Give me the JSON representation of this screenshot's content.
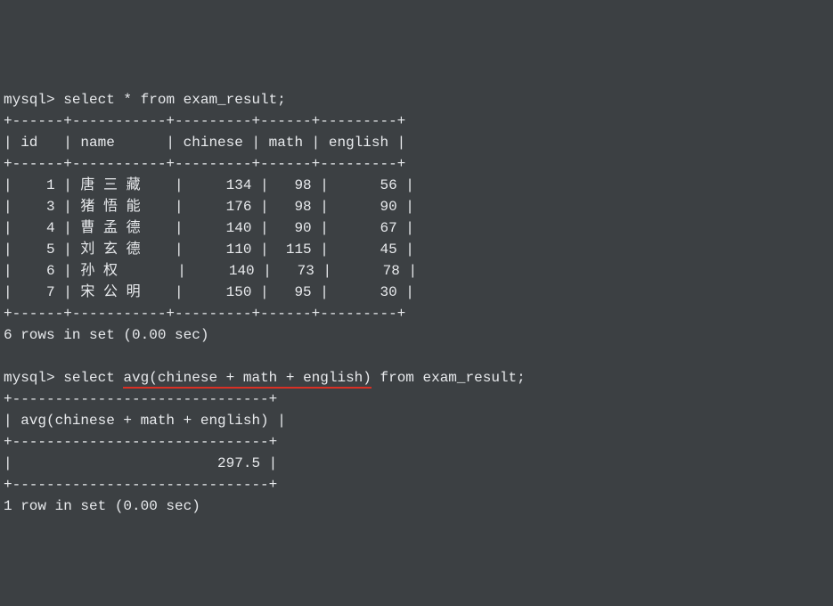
{
  "prompts": {
    "prompt1": "mysql> ",
    "query1": "select * from exam_result;",
    "prompt2": "mysql> ",
    "query2_pre": "select ",
    "query2_underlined": "avg(chinese + math + english)",
    "query2_post": " from exam_result;"
  },
  "table1": {
    "border_top": "+------+-----------+---------+------+---------+",
    "header": "| id   | name      | chinese | math | english |",
    "border_mid": "+------+-----------+---------+------+---------+",
    "row1": "|    1 | 唐 三 藏    |     134 |   98 |      56 |",
    "row2": "|    3 | 猪 悟 能    |     176 |   98 |      90 |",
    "row3": "|    4 | 曹 孟 德    |     140 |   90 |      67 |",
    "row4": "|    5 | 刘 玄 德    |     110 |  115 |      45 |",
    "row5": "|    6 | 孙 权       |     140 |   73 |      78 |",
    "row6": "|    7 | 宋 公 明    |     150 |   95 |      30 |",
    "border_bot": "+------+-----------+---------+------+---------+",
    "summary": "6 rows in set (0.00 sec)"
  },
  "table2": {
    "border_top": "+------------------------------+",
    "header": "| avg(chinese + math + english) |",
    "border_mid": "+------------------------------+",
    "row1": "|                        297.5 |",
    "border_bot": "+------------------------------+",
    "summary": "1 row in set (0.00 sec)"
  },
  "chart_data": {
    "type": "table",
    "tables": [
      {
        "query": "select * from exam_result;",
        "columns": [
          "id",
          "name",
          "chinese",
          "math",
          "english"
        ],
        "rows": [
          [
            1,
            "唐三藏",
            134,
            98,
            56
          ],
          [
            3,
            "猪悟能",
            176,
            98,
            90
          ],
          [
            4,
            "曹孟德",
            140,
            90,
            67
          ],
          [
            5,
            "刘玄德",
            110,
            115,
            45
          ],
          [
            6,
            "孙权",
            140,
            73,
            78
          ],
          [
            7,
            "宋公明",
            150,
            95,
            30
          ]
        ],
        "row_count": 6,
        "time_sec": 0.0
      },
      {
        "query": "select avg(chinese + math + english) from exam_result;",
        "columns": [
          "avg(chinese + math + english)"
        ],
        "rows": [
          [
            297.5
          ]
        ],
        "row_count": 1,
        "time_sec": 0.0
      }
    ]
  }
}
